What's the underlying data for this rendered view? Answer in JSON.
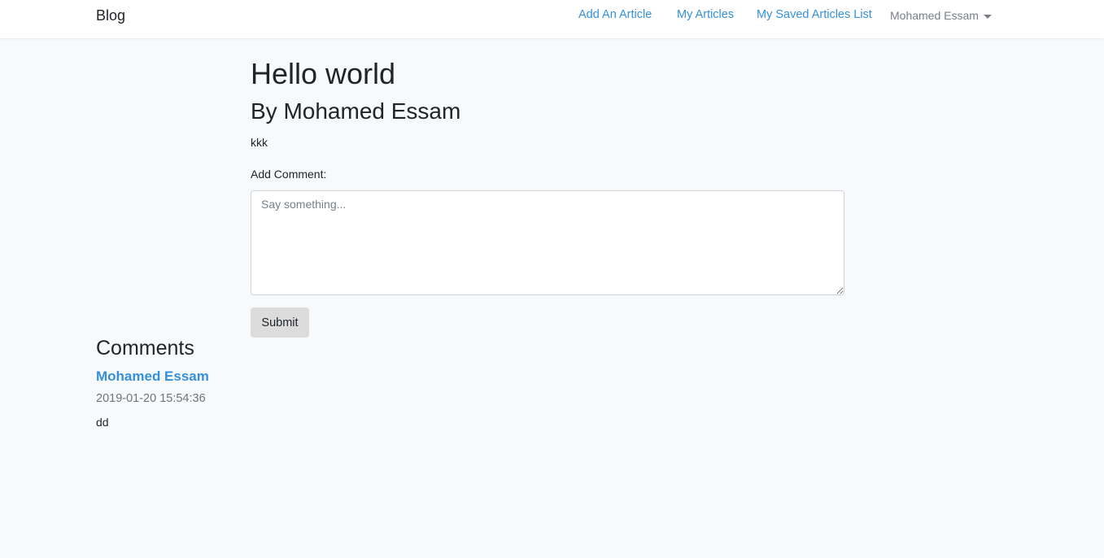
{
  "navbar": {
    "brand": "Blog",
    "links": [
      "Add An Article",
      "My Articles",
      "My Saved Articles List"
    ],
    "user_menu": "Mohamed Essam",
    "link_color": "#3490dc"
  },
  "article": {
    "title": "Hello world",
    "author": "By Mohamed Essam",
    "body": "kkk"
  },
  "comment_form": {
    "label": "Add Comment:",
    "placeholder": "Say something...",
    "value": "",
    "submit_label": "Submit"
  },
  "comments": {
    "heading": "Comments",
    "items": [
      {
        "author": "Mohamed Essam",
        "date": "2019-01-20 15:54:36",
        "text": "dd"
      }
    ]
  }
}
